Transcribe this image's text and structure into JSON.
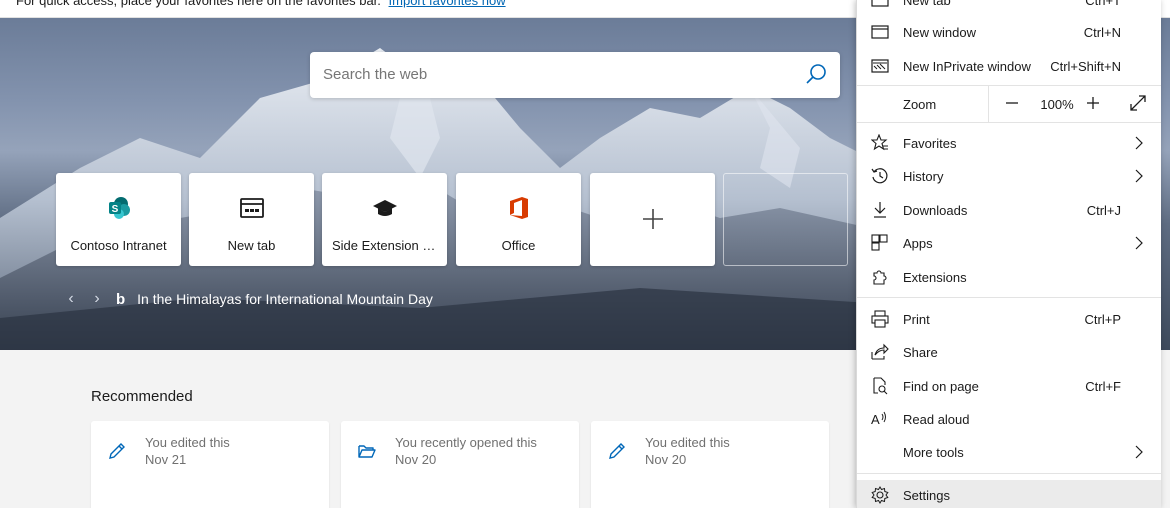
{
  "favorites_bar": {
    "text": "For quick access, place your favorites here on the favorites bar.",
    "link": "Import favorites now"
  },
  "search": {
    "placeholder": "Search the web"
  },
  "tiles": [
    {
      "label": "Contoso Intranet",
      "icon": "sharepoint-icon"
    },
    {
      "label": "New tab",
      "icon": "browser-window-icon"
    },
    {
      "label": "Side Extension S...",
      "icon": "graduation-cap-icon"
    },
    {
      "label": "Office",
      "icon": "office-icon"
    },
    {
      "label": "",
      "icon": "plus-icon"
    }
  ],
  "hero": {
    "caption": "In the Himalayas for International Mountain Day",
    "brand": "b"
  },
  "recommended": {
    "title": "Recommended",
    "cards": [
      {
        "line1": "You edited this",
        "line2": "Nov 21",
        "icon": "pencil-icon"
      },
      {
        "line1": "You recently opened this",
        "line2": "Nov 20",
        "icon": "folder-open-icon"
      },
      {
        "line1": "You edited this",
        "line2": "Nov 20",
        "icon": "pencil-icon"
      }
    ]
  },
  "menu": {
    "new_tab": {
      "label": "New tab",
      "shortcut": "Ctrl+T"
    },
    "new_window": {
      "label": "New window",
      "shortcut": "Ctrl+N"
    },
    "new_inprivate": {
      "label": "New InPrivate window",
      "shortcut": "Ctrl+Shift+N"
    },
    "zoom": {
      "label": "Zoom",
      "value": "100%"
    },
    "favorites": {
      "label": "Favorites"
    },
    "history": {
      "label": "History"
    },
    "downloads": {
      "label": "Downloads",
      "shortcut": "Ctrl+J"
    },
    "apps": {
      "label": "Apps"
    },
    "extensions": {
      "label": "Extensions"
    },
    "print": {
      "label": "Print",
      "shortcut": "Ctrl+P"
    },
    "share": {
      "label": "Share"
    },
    "find": {
      "label": "Find on page",
      "shortcut": "Ctrl+F"
    },
    "read_aloud": {
      "label": "Read aloud"
    },
    "more_tools": {
      "label": "More tools"
    },
    "settings": {
      "label": "Settings"
    }
  },
  "colors": {
    "accent_link": "#0066b4",
    "office_red": "#d83b01",
    "sharepoint_teal": "#038387"
  }
}
